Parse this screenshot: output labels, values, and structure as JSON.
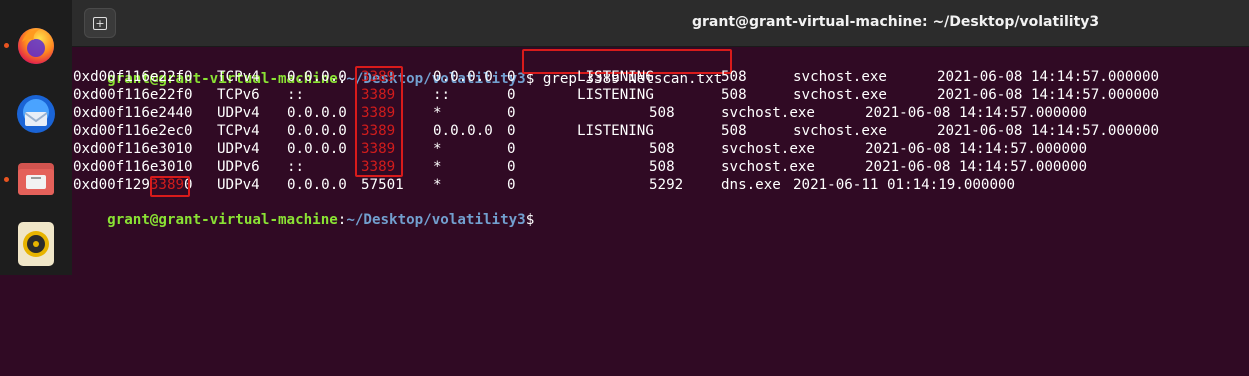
{
  "window": {
    "title": "grant@grant-virtual-machine: ~/Desktop/volatility3",
    "new_tab_icon": "plus-square-icon"
  },
  "dock": {
    "apps": [
      {
        "name": "firefox-icon",
        "running": true
      },
      {
        "name": "thunderbird-icon",
        "running": false
      },
      {
        "name": "files-icon",
        "running": true
      },
      {
        "name": "rhythmbox-icon",
        "running": false
      }
    ]
  },
  "colors": {
    "background": "#300a24",
    "prompt_user": "#8ae234",
    "prompt_path": "#729fcf",
    "highlight": "#d01c1c"
  },
  "prompt": {
    "user_host": "grant@grant-virtual-machine",
    "sep": ":",
    "path": "~/Desktop/volatility3",
    "dollar": "$"
  },
  "command": "grep 3389 Netscan.txt",
  "rows": [
    {
      "offset": "0xd00f116e22f0",
      "proto": "TCPv4",
      "laddr": "0.0.0.0",
      "lport": "3389",
      "faddr": "0.0.0.0",
      "fport": "0",
      "state": "LISTENING",
      "pid": "508",
      "owner": "svchost.exe",
      "created": "2021-06-08 14:14:57.000000"
    },
    {
      "offset": "0xd00f116e22f0",
      "proto": "TCPv6",
      "laddr": "::",
      "lport": "3389",
      "faddr": "::",
      "fport": "0",
      "state": "LISTENING",
      "pid": "508",
      "owner": "svchost.exe",
      "created": "2021-06-08 14:14:57.000000"
    },
    {
      "offset": "0xd00f116e2440",
      "proto": "UDPv4",
      "laddr": "0.0.0.0",
      "lport": "3389",
      "faddr": "*",
      "fport": "0",
      "state": "",
      "pid": "508",
      "owner": "svchost.exe",
      "created": "2021-06-08 14:14:57.000000"
    },
    {
      "offset": "0xd00f116e2ec0",
      "proto": "TCPv4",
      "laddr": "0.0.0.0",
      "lport": "3389",
      "faddr": "0.0.0.0",
      "fport": "0",
      "state": "LISTENING",
      "pid": "508",
      "owner": "svchost.exe",
      "created": "2021-06-08 14:14:57.000000"
    },
    {
      "offset": "0xd00f116e3010",
      "proto": "UDPv4",
      "laddr": "0.0.0.0",
      "lport": "3389",
      "faddr": "*",
      "fport": "0",
      "state": "",
      "pid": "508",
      "owner": "svchost.exe",
      "created": "2021-06-08 14:14:57.000000"
    },
    {
      "offset": "0xd00f116e3010",
      "proto": "UDPv6",
      "laddr": "::",
      "lport": "3389",
      "faddr": "*",
      "fport": "0",
      "state": "",
      "pid": "508",
      "owner": "svchost.exe",
      "created": "2021-06-08 14:14:57.000000"
    }
  ],
  "last_row": {
    "offset_pre": "0xd00f129",
    "offset_match": "3389",
    "offset_post": "0",
    "proto": "UDPv4",
    "laddr": "0.0.0.0",
    "lport": "57501",
    "faddr": "*",
    "fport": "0",
    "pid": "5292",
    "owner": "dns.exe",
    "created": "2021-06-11 01:14:19.000000"
  }
}
